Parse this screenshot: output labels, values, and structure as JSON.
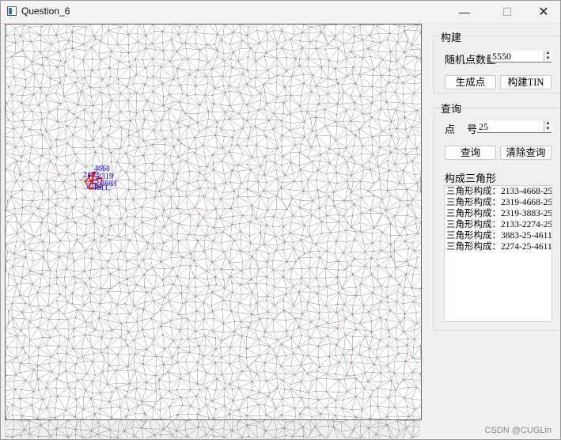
{
  "window": {
    "title": "Question_6",
    "minimize_glyph": "—",
    "maximize_glyph": "☐",
    "close_glyph": "✕"
  },
  "canvas": {
    "mesh_color": "#8a8a8a",
    "point_color": "#c04040",
    "highlight_color": "#ff0000",
    "label_color": "#0000ff",
    "highlight_labels": [
      "4668",
      "2319",
      "2133",
      "25",
      "3883",
      "2274",
      "4611"
    ]
  },
  "build": {
    "group_title": "构建",
    "points_label": "随机点数量",
    "points_value": "5550",
    "generate_button": "生成点",
    "build_tin_button": "构建TIN"
  },
  "query": {
    "group_title": "查询",
    "point_label": "点",
    "number_label": "号",
    "point_value": "25",
    "query_button": "查询",
    "clear_button": "清除查询",
    "result_label": "构成三角形",
    "results": [
      "三角形构成：2133-4668-25",
      "三角形构成：2319-4668-25",
      "三角形构成：2319-3883-25",
      "三角形构成：2133-2274-25",
      "三角形构成：3883-25-4611",
      "三角形构成：2274-25-4611"
    ]
  },
  "watermark": "CSDN @CUGLin"
}
